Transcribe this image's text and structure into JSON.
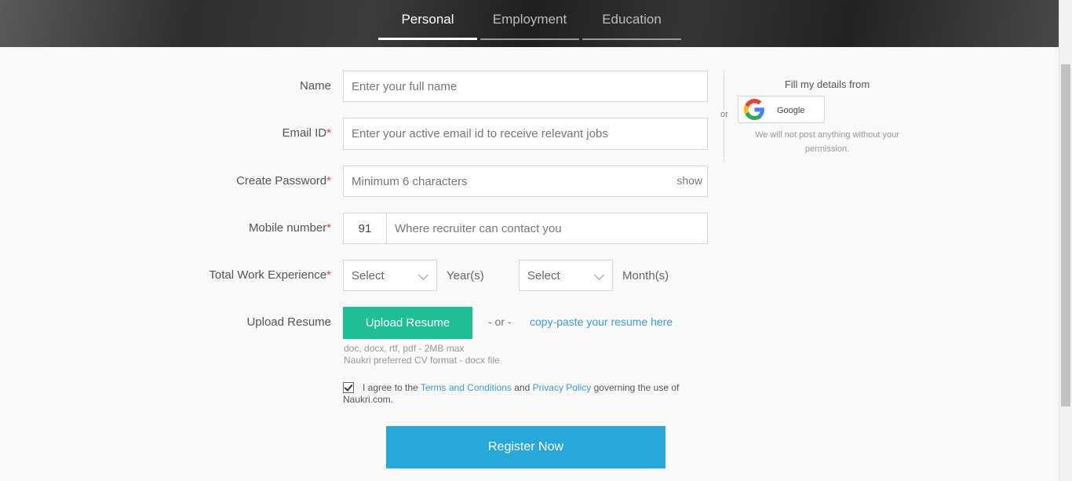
{
  "tabs": [
    {
      "label": "Personal",
      "active": true
    },
    {
      "label": "Employment",
      "active": false
    },
    {
      "label": "Education",
      "active": false
    }
  ],
  "form": {
    "name": {
      "label": "Name",
      "placeholder": "Enter your full name"
    },
    "email": {
      "label": "Email ID",
      "required_mark": "*",
      "placeholder": "Enter your active email id to receive relevant jobs"
    },
    "password": {
      "label": "Create Password",
      "required_mark": "*",
      "placeholder": "Minimum 6 characters",
      "show_label": "show"
    },
    "mobile": {
      "label": "Mobile number",
      "required_mark": "*",
      "country_code": "91",
      "placeholder": "Where recruiter can contact you"
    },
    "experience": {
      "label": "Total Work Experience",
      "required_mark": "*",
      "years_value": "Select",
      "years_unit": "Year(s)",
      "months_value": "Select",
      "months_unit": "Month(s)"
    },
    "resume": {
      "label": "Upload Resume",
      "button": "Upload Resume",
      "or_text": "- or -",
      "copy_link": "copy-paste your resume here",
      "hint1": "doc, docx, rtf, pdf - 2MB max",
      "hint2": "Naukri preferred CV format - docx file"
    },
    "agree": {
      "checked": true,
      "prefix": "I agree to the ",
      "terms": "Terms and Conditions",
      "middle": " and ",
      "privacy": "Privacy Policy",
      "suffix": " governing the use of Naukri.com."
    },
    "register_button": "Register Now"
  },
  "social": {
    "or_text": "or",
    "title": "Fill my details from",
    "google_label": "Google",
    "note": "We will not post anything without your permission."
  },
  "colors": {
    "accent_green": "#1fbf95",
    "accent_blue": "#27a8d8",
    "link_blue": "#3a9fd6",
    "required_red": "#e0423a"
  }
}
